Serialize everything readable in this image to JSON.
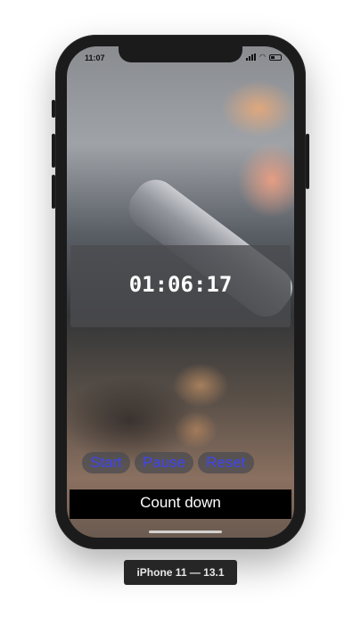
{
  "status_bar": {
    "time": "11:07",
    "icons": [
      "signal-icon",
      "wifi-icon",
      "battery-icon"
    ]
  },
  "timer": {
    "display": "01:06:17"
  },
  "controls": {
    "start_label": "Start",
    "pause_label": "Pause",
    "reset_label": "Reset",
    "accent_color": "#3f45f0"
  },
  "mode": {
    "label": "Count down"
  },
  "device_label": "iPhone 11 — 13.1"
}
